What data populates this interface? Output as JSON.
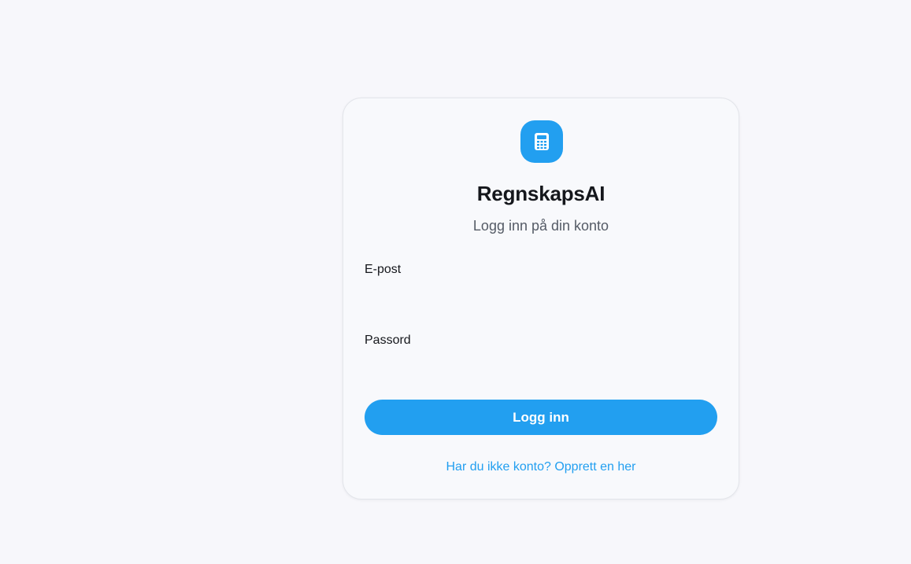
{
  "app": {
    "name": "RegnskapsAI",
    "subtitle": "Logg inn på din konto",
    "logo_icon": "calculator-icon"
  },
  "form": {
    "email_label": "E-post",
    "email_value": "",
    "email_placeholder": "",
    "password_label": "Passord",
    "password_value": "",
    "password_placeholder": "",
    "submit_label": "Logg inn"
  },
  "signup_link": {
    "label": "Har du ikke konto? Opprett en her"
  },
  "colors": {
    "accent": "#229ff0",
    "background": "#f7f7fb",
    "card": "#f8f9fc",
    "text": "#15171c",
    "muted": "#555b66"
  }
}
